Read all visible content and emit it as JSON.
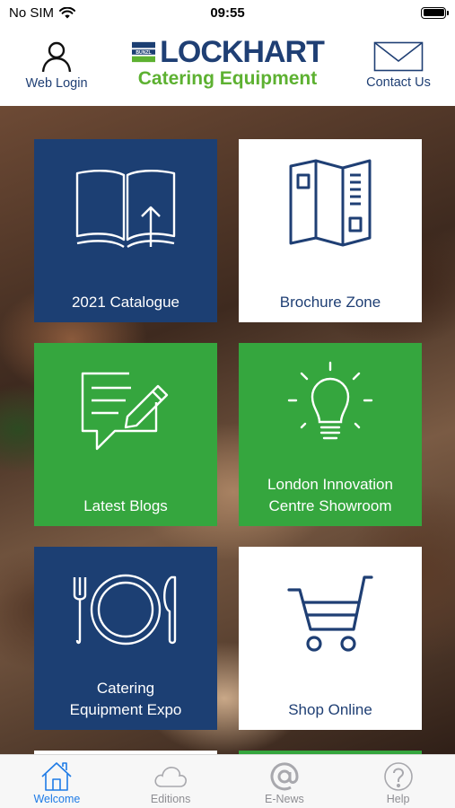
{
  "status": {
    "carrier": "No SIM",
    "time": "09:55"
  },
  "header": {
    "left_label": "Web Login",
    "right_label": "Contact Us",
    "logo_title": "LOCKHART",
    "logo_subtitle": "Catering Equipment",
    "logo_mark_text": "BUNZL"
  },
  "tiles": [
    {
      "label": "2021 Catalogue",
      "icon": "open-book-icon",
      "color": "#1c3f73"
    },
    {
      "label": "Brochure Zone",
      "icon": "brochure-icon",
      "color": "#ffffff"
    },
    {
      "label": "Latest Blogs",
      "icon": "blog-edit-icon",
      "color": "#35a63e"
    },
    {
      "label_line1": "London Innovation",
      "label_line2": "Centre Showroom",
      "icon": "lightbulb-icon",
      "color": "#35a63e"
    },
    {
      "label_line1": "Catering",
      "label_line2": "Equipment Expo",
      "icon": "plate-cutlery-icon",
      "color": "#1c3f73"
    },
    {
      "label": "Shop Online",
      "icon": "shopping-cart-icon",
      "color": "#ffffff"
    }
  ],
  "tabs": [
    {
      "label": "Welcome",
      "icon": "home-icon",
      "active": true
    },
    {
      "label": "Editions",
      "icon": "cloud-icon",
      "active": false
    },
    {
      "label": "E-News",
      "icon": "at-sign-icon",
      "active": false
    },
    {
      "label": "Help",
      "icon": "question-icon",
      "active": false
    }
  ],
  "colors": {
    "navy": "#1c3f73",
    "green": "#35a63e",
    "tab_active": "#1e7be6",
    "tab_inactive": "#8e8e93"
  }
}
